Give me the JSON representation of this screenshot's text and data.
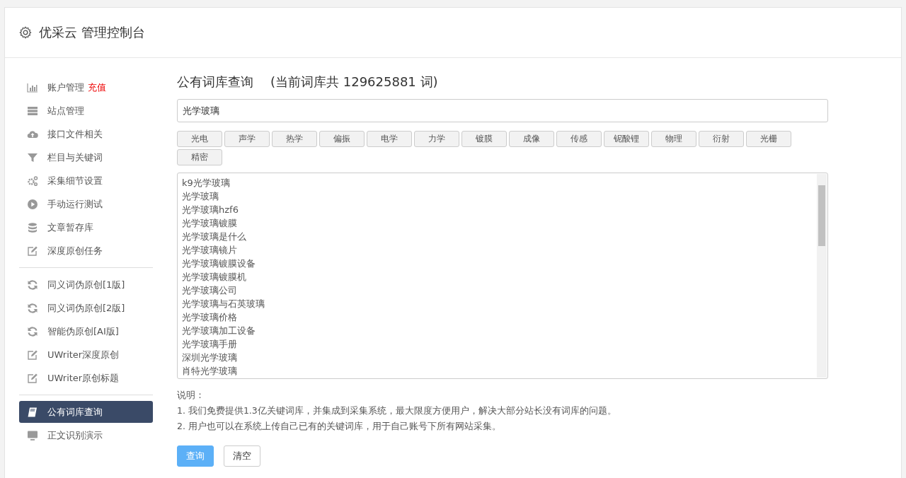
{
  "header": {
    "title": "优采云 管理控制台"
  },
  "sidebar": {
    "groups": [
      [
        {
          "label": "账户管理",
          "extra": "充值",
          "selected": false
        },
        {
          "label": "站点管理",
          "selected": false
        },
        {
          "label": "接口文件相关",
          "selected": false
        },
        {
          "label": "栏目与关键词",
          "selected": false
        },
        {
          "label": "采集细节设置",
          "selected": false
        },
        {
          "label": "手动运行测试",
          "selected": false
        },
        {
          "label": "文章暂存库",
          "selected": false
        },
        {
          "label": "深度原创任务",
          "selected": false
        }
      ],
      [
        {
          "label": "同义词伪原创[1版]",
          "selected": false
        },
        {
          "label": "同义词伪原创[2版]",
          "selected": false
        },
        {
          "label": "智能伪原创[AI版]",
          "selected": false
        },
        {
          "label": "UWriter深度原创",
          "selected": false
        },
        {
          "label": "UWriter原创标题",
          "selected": false
        }
      ],
      [
        {
          "label": "公有词库查询",
          "selected": true
        },
        {
          "label": "正文识别演示",
          "selected": false
        }
      ]
    ]
  },
  "main": {
    "title": "公有词库查询",
    "count_text": "(当前词库共 129625881 词)",
    "search": {
      "value": "光学玻璃"
    },
    "tags": [
      "光电",
      "声学",
      "热学",
      "偏振",
      "电学",
      "力学",
      "镀膜",
      "成像",
      "传感",
      "铌酸锂",
      "物理",
      "衍射",
      "光栅",
      "精密"
    ],
    "results": [
      "k9光学玻璃",
      "光学玻璃",
      "光学玻璃hzf6",
      "光学玻璃镀膜",
      "光学玻璃是什么",
      "光学玻璃镜片",
      "光学玻璃镀膜设备",
      "光学玻璃镀膜机",
      "光学玻璃公司",
      "光学玻璃与石英玻璃",
      "光学玻璃价格",
      "光学玻璃加工设备",
      "光学玻璃手册",
      "深圳光学玻璃",
      "肖特光学玻璃"
    ],
    "notes": [
      "说明：",
      "1. 我们免费提供1.3亿关键词库，并集成到采集系统，最大限度方便用户，解决大部分站长没有词库的问题。",
      "2. 用户也可以在系统上传自己已有的关键词库，用于自己账号下所有网站采集。"
    ],
    "buttons": [
      {
        "label": "查询",
        "kind": "primary"
      },
      {
        "label": "清空",
        "kind": "default"
      }
    ]
  }
}
